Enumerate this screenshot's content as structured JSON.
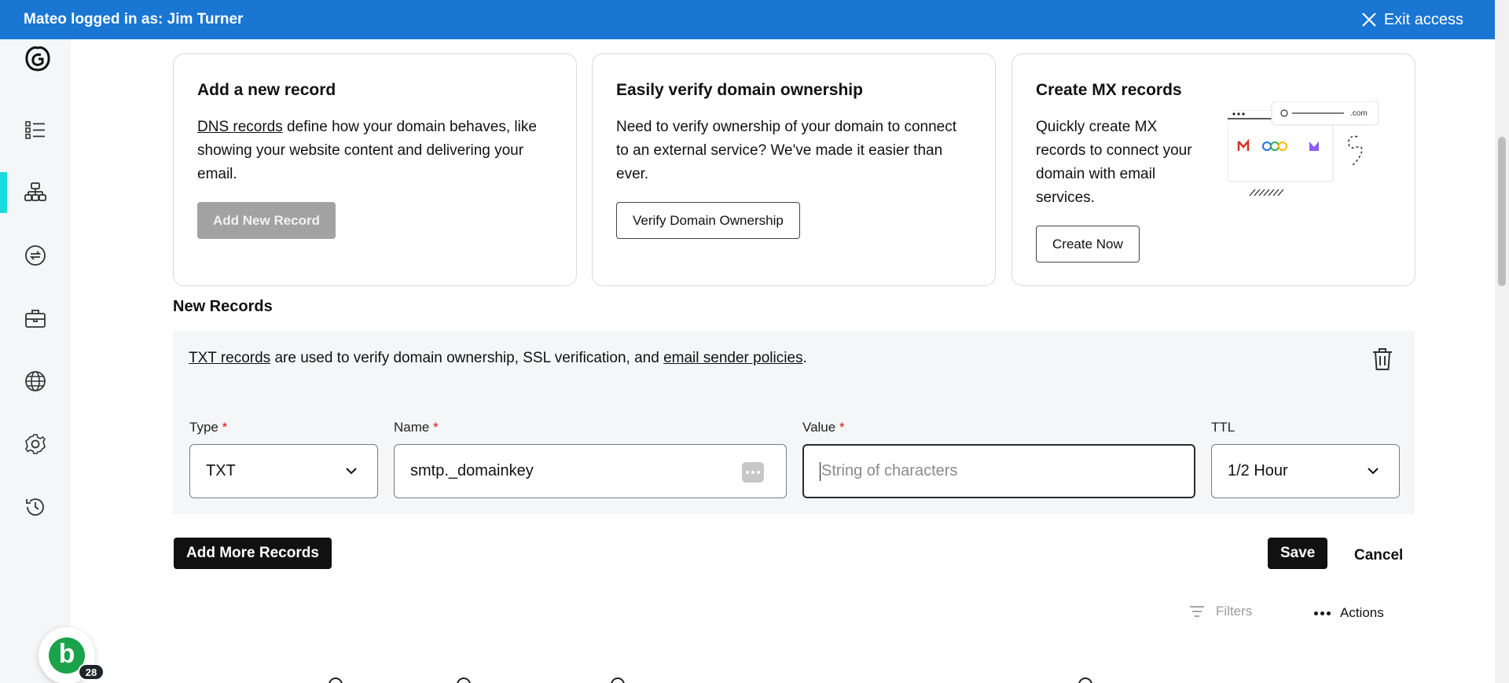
{
  "topbar": {
    "logged_in_text": "Mateo logged in as: Jim Turner",
    "exit_label": "Exit access"
  },
  "sidebar": {
    "items": [
      {
        "icon": "list-icon",
        "active": false
      },
      {
        "icon": "sitemap-icon",
        "active": true
      },
      {
        "icon": "transfer-icon",
        "active": false
      },
      {
        "icon": "briefcase-icon",
        "active": false
      },
      {
        "icon": "globe-icon",
        "active": false
      },
      {
        "icon": "gear-icon",
        "active": false
      },
      {
        "icon": "history-icon",
        "active": false
      }
    ],
    "avatar_letter": "b",
    "avatar_badge": "28"
  },
  "cards": {
    "add_record": {
      "title": "Add a new record",
      "link": "DNS records",
      "text": " define how your domain behaves, like showing your website content and delivering your email.",
      "button": "Add New Record"
    },
    "verify": {
      "title": "Easily verify domain ownership",
      "text": "Need to verify ownership of your domain to connect to an external service? We've made it easier than ever.",
      "button": "Verify Domain Ownership"
    },
    "mx": {
      "title": "Create MX records",
      "text": "Quickly create MX records to connect your domain with email services.",
      "button": "Create Now",
      "illustration_text": ".com"
    }
  },
  "new_records": {
    "title": "New Records",
    "info_link1": "TXT records",
    "info_mid": " are used to verify domain ownership, SSL verification, and ",
    "info_link2": "email sender policies",
    "info_end": ".",
    "fields": {
      "type": {
        "label": "Type",
        "required": "*",
        "value": "TXT"
      },
      "name": {
        "label": "Name",
        "required": "*",
        "value": "smtp._domainkey"
      },
      "value": {
        "label": "Value",
        "required": "*",
        "placeholder": "String of characters"
      },
      "ttl": {
        "label": "TTL",
        "value": "1/2 Hour"
      }
    }
  },
  "buttons": {
    "add_more": "Add More Records",
    "save": "Save",
    "cancel": "Cancel"
  },
  "table_controls": {
    "filters": "Filters",
    "actions": "Actions"
  }
}
